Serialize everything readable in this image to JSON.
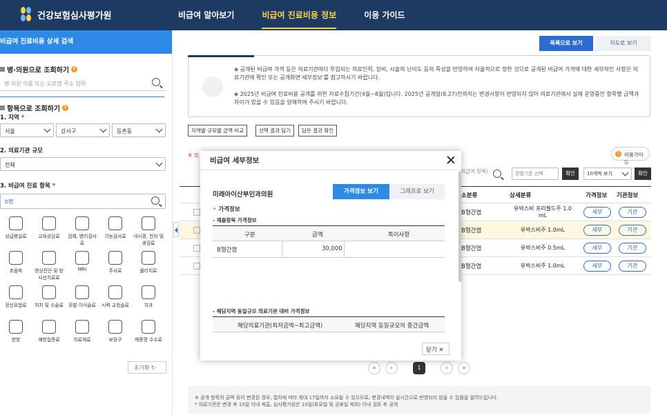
{
  "header": {
    "logo_text": "건강보험심사평가원",
    "nav": [
      "비급여 알아보기",
      "비급여 진료비용 정보",
      "이용 가이드"
    ]
  },
  "sidebar": {
    "title": "비급여 진료비용 상세 검색",
    "hospital_search_title": "병·의원으로 조회하기",
    "hospital_search_placeholder": "병·의원 이름 또는 도로명 주소 입력",
    "item_search_title": "항목으로 조회하기",
    "region_label": "1. 지역",
    "region_values": [
      "서울",
      "강서구",
      "등촌동"
    ],
    "size_label": "2. 의료기관 규모",
    "size_value": "전체",
    "item_label": "3. 비급여 진료 항목",
    "item_value": "b형",
    "categories": [
      "상급병실료",
      "교육상담료",
      "검체, 병리검사료",
      "기능검사료",
      "내시경, 천자 및 생검료",
      "초음파",
      "영상진단 및 방사선치료료",
      "MRI",
      "주사료",
      "물리치료",
      "정신요법료",
      "처치 및 수술료",
      "모발 이식술료",
      "시력 교정술료",
      "치과",
      "한방",
      "예방접종료",
      "치료재료",
      "보장구",
      "제증명 수수료"
    ],
    "reset_label": "초기화"
  },
  "main": {
    "list_view": "목록으로 보기",
    "map_view": "지도로 보기",
    "notice1": "◈ 공개된 비급여 가격 등은 의료기관마다 투입되는 의료인력, 장비, 시술의 난이도 등의 특성을 반영하여 자율적으로 정한 것으로 공개된 비급여 가격에 대한 세부적인 사항은 의료기관에 확인 또는 공개화면'세부정보'를 참고하시기 바랍니다.",
    "notice2": "◈ 2025년 비급여 진료비용 공개를 위한 자료수집기간(4월~8월)입니다. 2025년 공개일(8.27)전까지는 변경사항이 반영되지 않아 의료기관에서 실제 운영중인 항목별 금액과 차이가 있을 수 있음을 양해하여 주시기 바랍니다.",
    "btn_compare": "지역별·규모별 금액 비교",
    "btn_select": "선택 결과 담기",
    "btn_view": "담은 결과 확인",
    "usage_guide": "이용가이드",
    "warn_prefix": "※ 의",
    "search_hint": "(비급여 항목)",
    "sort_placeholder": "정렬기준 선택",
    "confirm": "확인",
    "per_page": "10개씩 보기",
    "columns": [
      "소분류",
      "상세분류",
      "가격정보",
      "기관정보"
    ],
    "rows": [
      {
        "sub": "B형간염",
        "detail": "유박스비 프리필드주 1.0 mL"
      },
      {
        "sub": "B형간염",
        "detail": "유박스비주 1.0mL"
      },
      {
        "sub": "B형간염",
        "detail": "유박스비주 0.5mL"
      },
      {
        "sub": "B형간염",
        "detail": "유박스비주 1.0mL"
      }
    ],
    "detail_btn": "세부",
    "org_btn": "기관",
    "current_page": "1",
    "footer1": "※ 공개 항목의 금액 등이 변경된 경우, 절차에 따라 최대 17일까지 소요될 수 있으므로, 변경내역이 실시간으로 반영되지 않을 수 있음을 알려드립니다.",
    "footer2": "* 의료기관은 변경 후 10일 이내 제출, 심사평가원은 10일(토요일 및 공휴일 제외) 이내 검토 후 공개"
  },
  "modal": {
    "title": "비급여 세부정보",
    "hospital": "미래아이산부인과의원",
    "tab_price": "가격정보 보기",
    "tab_graph": "그래프로 보기",
    "section": "가격정보",
    "sub1": "- 제출항목 가격정보",
    "cols1": [
      "구분",
      "금액",
      "특이사항"
    ],
    "row1": {
      "type": "B형간염",
      "amount": "30,000",
      "note": ""
    },
    "sub2": "- 해당지역 동일규모 의료기관 대비 가격정보",
    "cols2": [
      "해당의료기관(최저금액~최고금액)",
      "해당지역 동일규모의 중간금액"
    ],
    "close": "닫기"
  }
}
